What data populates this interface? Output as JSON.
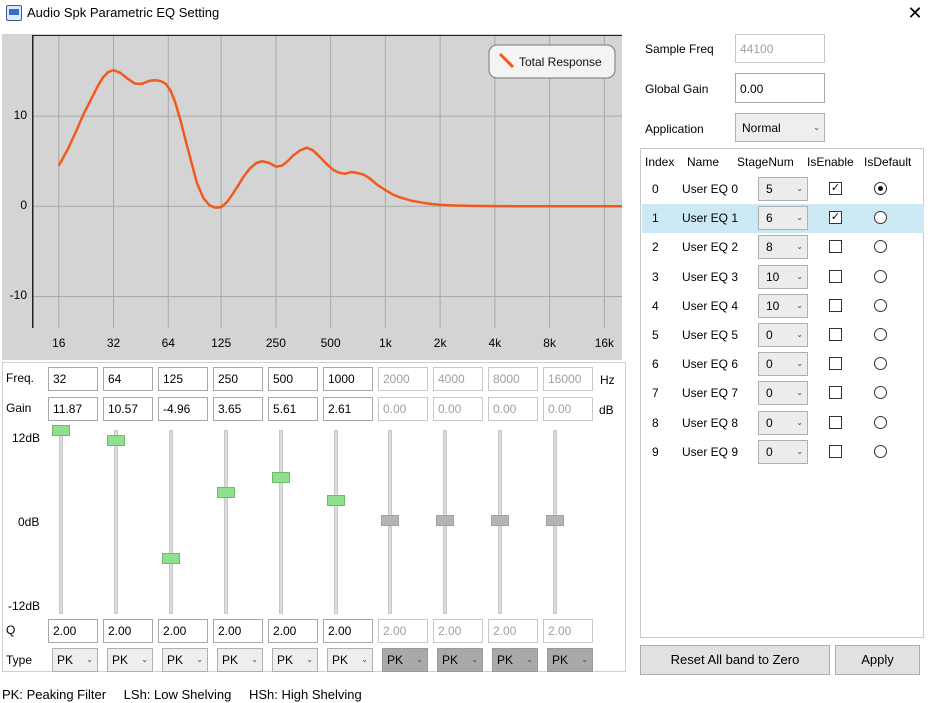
{
  "window": {
    "title": "Audio Spk Parametric EQ Setting",
    "close_label": "✕"
  },
  "chart_data": {
    "type": "line",
    "x_scale": "log",
    "x_ticks": [
      "16",
      "32",
      "64",
      "125",
      "250",
      "500",
      "1k",
      "2k",
      "4k",
      "8k",
      "16k"
    ],
    "y_ticks": [
      "10",
      "0",
      "-10"
    ],
    "ylim": [
      -13.5,
      19
    ],
    "grid": true,
    "legend": "top-right",
    "series": [
      {
        "name": "Total Response",
        "color": "#f05a1e",
        "x": [
          16,
          18,
          20,
          22,
          24,
          26,
          28,
          30,
          32,
          35,
          38,
          42,
          46,
          50,
          54,
          58,
          62,
          66,
          70,
          75,
          80,
          86,
          92,
          100,
          108,
          116,
          125,
          135,
          145,
          155,
          165,
          180,
          195,
          210,
          230,
          250,
          270,
          290,
          310,
          340,
          370,
          400,
          440,
          480,
          520,
          560,
          600,
          650,
          700,
          760,
          820,
          900,
          1000,
          1100,
          1200,
          1400,
          1600,
          1800,
          2000,
          2500,
          3000,
          4000,
          5000,
          6000,
          8000,
          10000,
          12000,
          16000,
          20000
        ],
        "y": [
          4.5,
          6.4,
          8.4,
          10.3,
          11.8,
          13.2,
          14.3,
          14.9,
          15.1,
          14.8,
          14.2,
          13.6,
          13.6,
          13.9,
          14.0,
          13.9,
          13.6,
          12.8,
          11.5,
          9.4,
          7.2,
          4.8,
          2.6,
          0.9,
          0.1,
          -0.15,
          -0.1,
          0.5,
          1.4,
          2.3,
          3.2,
          4.2,
          4.8,
          5.0,
          4.8,
          4.4,
          4.5,
          5.0,
          5.6,
          6.2,
          6.5,
          6.2,
          5.4,
          4.6,
          4.0,
          3.7,
          3.6,
          3.8,
          3.7,
          3.5,
          3.1,
          2.4,
          1.8,
          1.3,
          1.0,
          0.6,
          0.4,
          0.25,
          0.15,
          0.08,
          0.04,
          0.02,
          0.01,
          0,
          0,
          0,
          0,
          0,
          0
        ]
      }
    ]
  },
  "bands": {
    "freq_label": "Freq.",
    "freq_unit": "Hz",
    "gain_label": "Gain",
    "gain_unit": "dB",
    "q_label": "Q",
    "type_label": "Type",
    "scale_top": "12dB",
    "scale_mid": "0dB",
    "scale_bottom": "-12dB",
    "items": [
      {
        "freq": "32",
        "gain": "11.87",
        "q": "2.00",
        "type": "PK",
        "level": 11.87,
        "enabled": true
      },
      {
        "freq": "64",
        "gain": "10.57",
        "q": "2.00",
        "type": "PK",
        "level": 10.57,
        "enabled": true
      },
      {
        "freq": "125",
        "gain": "-4.96",
        "q": "2.00",
        "type": "PK",
        "level": -4.96,
        "enabled": true
      },
      {
        "freq": "250",
        "gain": "3.65",
        "q": "2.00",
        "type": "PK",
        "level": 3.65,
        "enabled": true
      },
      {
        "freq": "500",
        "gain": "5.61",
        "q": "2.00",
        "type": "PK",
        "level": 5.61,
        "enabled": true
      },
      {
        "freq": "1000",
        "gain": "2.61",
        "q": "2.00",
        "type": "PK",
        "level": 2.61,
        "enabled": true
      },
      {
        "freq": "2000",
        "gain": "0.00",
        "q": "2.00",
        "type": "PK",
        "level": 0,
        "enabled": false
      },
      {
        "freq": "4000",
        "gain": "0.00",
        "q": "2.00",
        "type": "PK",
        "level": 0,
        "enabled": false
      },
      {
        "freq": "8000",
        "gain": "0.00",
        "q": "2.00",
        "type": "PK",
        "level": 0,
        "enabled": false
      },
      {
        "freq": "16000",
        "gain": "0.00",
        "q": "2.00",
        "type": "PK",
        "level": 0,
        "enabled": false
      }
    ]
  },
  "settings": {
    "sample_freq_label": "Sample Freq",
    "sample_freq": "44100",
    "global_gain_label": "Global Gain",
    "global_gain": "0.00",
    "application_label": "Application",
    "application": "Normal"
  },
  "eq_table": {
    "headers": [
      "Index",
      "Name",
      "StageNum",
      "IsEnable",
      "IsDefault"
    ],
    "rows": [
      {
        "index": "0",
        "name": "User EQ 0",
        "stage": "5",
        "enabled": true,
        "default": true,
        "selected": false
      },
      {
        "index": "1",
        "name": "User EQ 1",
        "stage": "6",
        "enabled": true,
        "default": false,
        "selected": true
      },
      {
        "index": "2",
        "name": "User EQ 2",
        "stage": "8",
        "enabled": false,
        "default": false,
        "selected": false
      },
      {
        "index": "3",
        "name": "User EQ 3",
        "stage": "10",
        "enabled": false,
        "default": false,
        "selected": false
      },
      {
        "index": "4",
        "name": "User EQ 4",
        "stage": "10",
        "enabled": false,
        "default": false,
        "selected": false
      },
      {
        "index": "5",
        "name": "User EQ 5",
        "stage": "0",
        "enabled": false,
        "default": false,
        "selected": false
      },
      {
        "index": "6",
        "name": "User EQ 6",
        "stage": "0",
        "enabled": false,
        "default": false,
        "selected": false
      },
      {
        "index": "7",
        "name": "User EQ 7",
        "stage": "0",
        "enabled": false,
        "default": false,
        "selected": false
      },
      {
        "index": "8",
        "name": "User EQ 8",
        "stage": "0",
        "enabled": false,
        "default": false,
        "selected": false
      },
      {
        "index": "9",
        "name": "User EQ 9",
        "stage": "0",
        "enabled": false,
        "default": false,
        "selected": false
      }
    ]
  },
  "buttons": {
    "reset": "Reset All band to Zero",
    "apply": "Apply"
  },
  "footer": {
    "pk": "PK: Peaking Filter",
    "lsh": "LSh: Low Shelving",
    "hsh": "HSh: High Shelving"
  }
}
